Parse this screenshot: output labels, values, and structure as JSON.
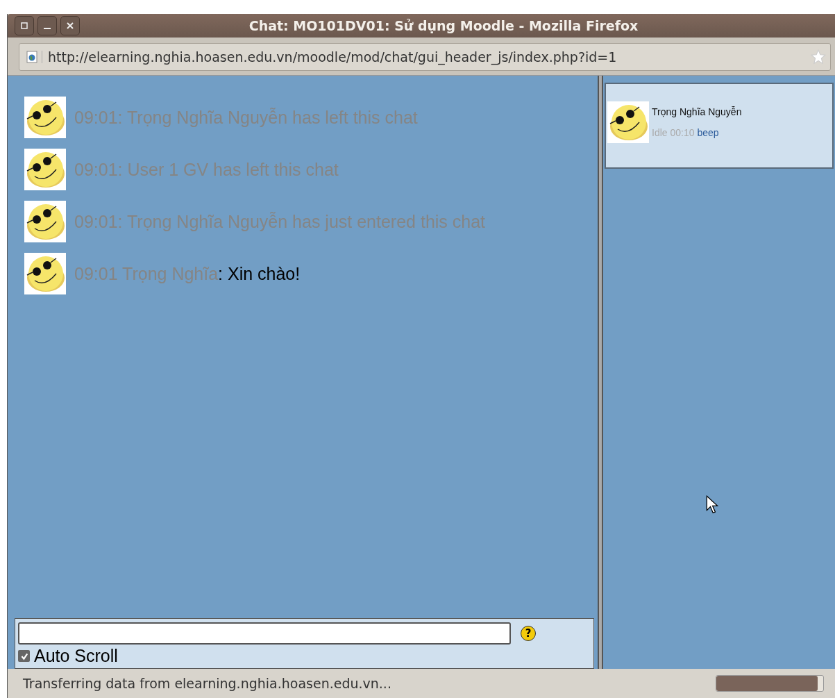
{
  "window": {
    "title": "Chat: MO101DV01: Sử dụng Moodle - Mozilla Firefox"
  },
  "address_bar": {
    "url": "http://elearning.nghia.hoasen.edu.vn/moodle/mod/chat/gui_header_js/index.php?id=1"
  },
  "messages": [
    {
      "kind": "system",
      "text": "09:01: Trọng Nghĩa Nguyễn has left this chat"
    },
    {
      "kind": "system",
      "text": "09:01: User 1 GV has left this chat"
    },
    {
      "kind": "system",
      "text": "09:01: Trọng Nghĩa Nguyễn has just entered this chat"
    },
    {
      "kind": "message",
      "sender": "09:01 Trọng Nghĩa",
      "text": ": Xin chào!"
    }
  ],
  "input": {
    "help": "?",
    "auto_scroll": {
      "label": "Auto Scroll",
      "checked": true
    }
  },
  "users": [
    {
      "name": "Trọng Nghĩa Nguyễn",
      "idle": "Idle 00:10",
      "action": "beep"
    }
  ],
  "status_bar": {
    "text": "Transferring data from elearning.nghia.hoasen.edu.vn...",
    "level": 0.95
  }
}
